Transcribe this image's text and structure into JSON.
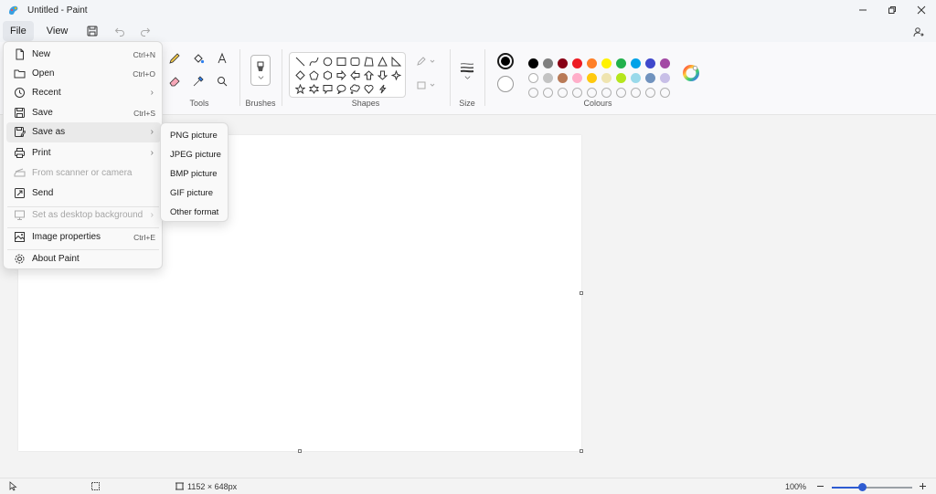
{
  "window": {
    "title": "Untitled - Paint"
  },
  "menubar": {
    "file": "File",
    "view": "View"
  },
  "ribbon": {
    "tools_label": "Tools",
    "brushes_label": "Brushes",
    "shapes_label": "Shapes",
    "size_label": "Size",
    "colours_label": "Colours",
    "current_color": "#000000",
    "secondary_color": "#ffffff",
    "palette_row1": [
      "#000000",
      "#7f7f7f",
      "#880015",
      "#ed1c24",
      "#ff7f27",
      "#fff200",
      "#22b14c",
      "#00a2e8",
      "#3f48cc",
      "#a349a4"
    ],
    "palette_row2": [
      "#ffffff",
      "#c3c3c3",
      "#b97a57",
      "#ffaec9",
      "#ffc90e",
      "#efe4b0",
      "#b5e61d",
      "#99d9ea",
      "#7092be",
      "#c8bfe7"
    ]
  },
  "file_menu": {
    "items": [
      {
        "label": "New",
        "shortcut": "Ctrl+N",
        "icon": "new-file-icon"
      },
      {
        "label": "Open",
        "shortcut": "Ctrl+O",
        "icon": "folder-icon"
      },
      {
        "label": "Recent",
        "shortcut": "",
        "icon": "clock-icon"
      },
      {
        "label": "Save",
        "shortcut": "Ctrl+S",
        "icon": "save-icon"
      },
      {
        "label": "Save as",
        "shortcut": "",
        "icon": "save-as-icon"
      },
      {
        "label": "Print",
        "shortcut": "",
        "icon": "printer-icon"
      },
      {
        "label": "From scanner or camera",
        "shortcut": "",
        "icon": "scanner-icon"
      },
      {
        "label": "Send",
        "shortcut": "",
        "icon": "send-icon"
      },
      {
        "label": "Set as desktop background",
        "shortcut": "",
        "icon": "desktop-icon"
      },
      {
        "label": "Image properties",
        "shortcut": "Ctrl+E",
        "icon": "image-properties-icon"
      },
      {
        "label": "About Paint",
        "shortcut": "",
        "icon": "gear-icon"
      }
    ]
  },
  "save_as_menu": {
    "items": [
      "PNG picture",
      "JPEG picture",
      "BMP picture",
      "GIF picture",
      "Other format"
    ]
  },
  "statusbar": {
    "dimensions": "1152 × 648px",
    "zoom": "100%",
    "zoom_fraction": 0.38
  }
}
